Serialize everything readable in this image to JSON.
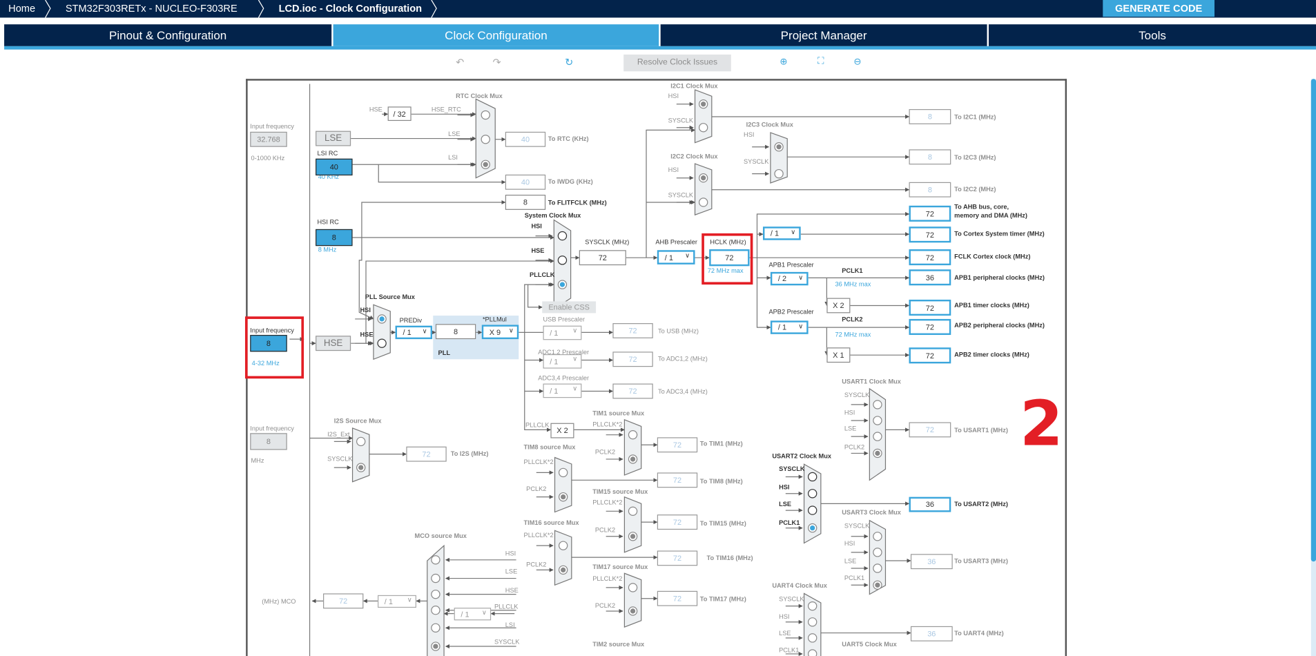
{
  "header": {
    "breadcrumbs": [
      "Home",
      "STM32F303RETx  -  NUCLEO-F303RE",
      "LCD.ioc - Clock Configuration"
    ],
    "generate_code": "GENERATE CODE"
  },
  "tabs": [
    {
      "label": "Pinout & Configuration",
      "active": false
    },
    {
      "label": "Clock Configuration",
      "active": true
    },
    {
      "label": "Project Manager",
      "active": false
    },
    {
      "label": "Tools",
      "active": false
    }
  ],
  "toolbar": {
    "undo_icon": "undo-icon",
    "redo_icon": "redo-icon",
    "refresh_icon": "refresh-icon",
    "resolve": "Resolve Clock Issues",
    "zoom_in_icon": "zoom-in-icon",
    "fit_icon": "fit-screen-icon",
    "zoom_out_icon": "zoom-out-icon"
  },
  "annotation": "2",
  "colors": {
    "navy": "#03234b",
    "accent": "#3ba6dc",
    "highlight": "#e31e25"
  },
  "diagram": {
    "labels": {
      "lse_in_title": "Input frequency",
      "lse_in_range": "0-1000 KHz",
      "lsi_rc": "LSI RC",
      "lsi_unit": "40 KHz",
      "hsi_rc": "HSI RC",
      "hsi_unit": "8 MHz",
      "hse_in_title": "Input frequency",
      "hse_in_range": "4-32 MHz",
      "i2s_in_title": "Input frequency",
      "i2s_in_unit": "MHz",
      "mco_label": "(MHz) MCO",
      "rtc_mux": "RTC Clock Mux",
      "rtc_hse": "HSE",
      "rtc_hse_rtc": "HSE_RTC",
      "rtc_lse": "LSE",
      "rtc_lsi": "LSI",
      "to_rtc": "To RTC (KHz)",
      "to_iwdg": "To IWDG (KHz)",
      "to_flitf": "To FLITFCLK (MHz)",
      "sys_mux": "System Clock Mux",
      "sys_hsi": "HSI",
      "sys_hse": "HSE",
      "sys_pll": "PLLCLK",
      "sysclk": "SYSCLK (MHz)",
      "ahb_pre": "AHB Prescaler",
      "hclk": "HCLK (MHz)",
      "hclk_max": "72 MHz max",
      "pll_mux": "PLL Source Mux",
      "pll_hsi": "HSI",
      "pll_hse": "HSE",
      "prediv": "PREDiv",
      "pllmul": "*PLLMul",
      "pll": "PLL",
      "usb_pre": "USB Prescaler",
      "to_usb": "To USB (MHz)",
      "adc12_pre": "ADC1,2 Prescaler",
      "to_adc12": "To ADC1,2 (MHz)",
      "adc34_pre": "ADC3,4 Prescaler",
      "to_adc34": "To ADC3,4 (MHz)",
      "i2c1_mux": "I2C1 Clock Mux",
      "i2c1_hsi": "HSI",
      "i2c1_sys": "SYSCLK",
      "to_i2c1": "To I2C1 (MHz)",
      "i2c3_mux": "I2C3 Clock Mux",
      "i2c3_hsi": "HSI",
      "i2c3_sys": "SYSCLK",
      "to_i2c3": "To I2C3 (MHz)",
      "i2c2_mux": "I2C2 Clock Mux",
      "i2c2_hsi": "HSI",
      "i2c2_sys": "SYSCLK",
      "to_i2c2": "To I2C2 (MHz)",
      "to_ahb1": "To AHB bus, core,",
      "to_ahb2": "memory and DMA (MHz)",
      "to_cortex": "To Cortex System timer (MHz)",
      "to_fclk": "FCLK Cortex clock (MHz)",
      "apb1_pre": "APB1 Prescaler",
      "pclk1": "PCLK1",
      "pclk1_max": "36 MHz max",
      "to_apb1": "APB1 peripheral clocks (MHz)",
      "to_apb1t": "APB1 timer clocks (MHz)",
      "apb2_pre": "APB2 Prescaler",
      "pclk2": "PCLK2",
      "pclk2_max": "72 MHz max",
      "to_apb2": "APB2 peripheral clocks (MHz)",
      "to_apb2t": "APB2 timer clocks (MHz)",
      "i2s_mux": "I2S Source Mux",
      "i2s_ext": "I2S_Ext",
      "i2s_sys": "SYSCLK",
      "to_i2s": "To I2S (MHz)",
      "tim_pllclk": "PLLCLK",
      "tim1_mux": "TIM1 source Mux",
      "tim1_a": "PLLCLK*2",
      "tim1_b": "PCLK2",
      "to_tim1": "To TIM1 (MHz)",
      "tim8_mux": "TIM8 source Mux",
      "tim8_a": "PLLCLK*2",
      "tim8_b": "PCLK2",
      "to_tim8": "To TIM8 (MHz)",
      "tim15_mux": "TIM15 source Mux",
      "tim15_a": "PLLCLK*2",
      "tim15_b": "PCLK2",
      "to_tim15": "To TIM15 (MHz)",
      "tim16_mux": "TIM16 source Mux",
      "tim16_a": "PLLCLK*2",
      "tim16_b": "PCLK2",
      "to_tim16": "To TIM16 (MHz)",
      "tim17_mux": "TIM17 source Mux",
      "tim17_a": "PLLCLK*2",
      "tim17_b": "PCLK2",
      "to_tim17": "To TIM17 (MHz)",
      "tim2_mux": "TIM2 source Mux",
      "mco_mux": "MCO source Mux",
      "mco_hsi": "HSI",
      "mco_lse": "LSE",
      "mco_hse": "HSE",
      "mco_pll": "PLLCLK",
      "mco_lsi": "LSI",
      "mco_sys": "SYSCLK",
      "usart1_mux": "USART1 Clock Mux",
      "u1_sys": "SYSCLK",
      "u1_hsi": "HSI",
      "u1_lse": "LSE",
      "u1_pclk": "PCLK2",
      "to_usart1": "To USART1 (MHz)",
      "usart2_mux": "USART2 Clock Mux",
      "u2_sys": "SYSCLK",
      "u2_hsi": "HSI",
      "u2_lse": "LSE",
      "u2_pclk": "PCLK1",
      "to_usart2": "To USART2 (MHz)",
      "usart3_mux": "USART3 Clock Mux",
      "u3_sys": "SYSCLK",
      "u3_hsi": "HSI",
      "u3_lse": "LSE",
      "u3_pclk": "PCLK1",
      "to_usart3": "To USART3 (MHz)",
      "uart4_mux": "UART4 Clock Mux",
      "u4_sys": "SYSCLK",
      "u4_hsi": "HSI",
      "u4_lse": "LSE",
      "u4_pclk": "PCLK1",
      "to_uart4": "To UART4 (MHz)",
      "uart5_mux": "UART5 Clock Mux"
    },
    "values": {
      "lse_in": "32.768",
      "lse": "LSE",
      "lsi": "40",
      "hsi": "8",
      "hse_in": "8",
      "hse": "HSE",
      "i2s_in": "8",
      "hse_div32": "/ 32",
      "rtc": "40",
      "iwdg": "40",
      "flitf": "8",
      "sysclk": "72",
      "hclk": "72",
      "enable_css": "Enable CSS",
      "pll_m": "8",
      "usb": "72",
      "adc12": "72",
      "adc34": "72",
      "i2c1": "8",
      "i2c3": "8",
      "i2c2": "8",
      "ahb": "72",
      "cortex": "72",
      "fclk": "72",
      "apb1": "36",
      "apb1_x": "X 2",
      "apb1t": "72",
      "apb2": "72",
      "apb2_x": "X 1",
      "apb2t": "72",
      "i2s": "72",
      "tim_x2": "X 2",
      "tim1": "72",
      "tim8": "72",
      "tim15": "72",
      "tim16": "72",
      "tim17": "72",
      "mco": "72",
      "usart1": "72",
      "usart2": "36",
      "usart3": "36",
      "uart4": "36"
    },
    "selects": {
      "ahb": "/ 1",
      "prediv": "/ 1",
      "pllmul": "X 9",
      "usb": "/ 1",
      "adc12": "/ 1",
      "adc34": "/ 1",
      "cortex": "/ 1",
      "apb1": "/ 2",
      "apb2": "/ 1",
      "mco_pll": "/ 1",
      "mco": "/ 1"
    },
    "mux_selection": {
      "rtc": "LSI",
      "system": "PLLCLK",
      "pll_source": "HSI",
      "i2c1": "HSI",
      "i2c2": "HSI",
      "i2c3": "HSI",
      "i2s": "SYSCLK",
      "tim1": "PCLK2",
      "tim8": "PCLK2",
      "tim15": "PCLK2",
      "tim16": "PCLK2",
      "tim17": "PCLK2",
      "mco": "SYSCLK",
      "usart1": "PCLK2",
      "usart2": "PCLK1",
      "usart3": "PCLK1"
    }
  }
}
